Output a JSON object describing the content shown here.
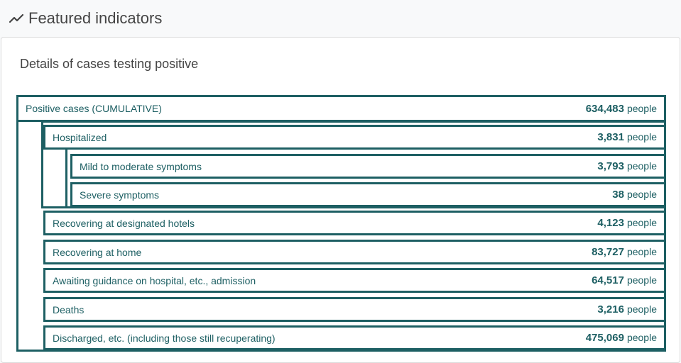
{
  "header": {
    "title": "Featured indicators",
    "icon": "trend-line-icon"
  },
  "card": {
    "title": "Details of cases testing positive"
  },
  "colors": {
    "accent": "#1d5f63",
    "text": "#444444",
    "background": "#f8f9fa"
  },
  "rows": [
    {
      "label": "Positive cases (CUMULATIVE)",
      "value": "634,483",
      "unit": "people"
    },
    {
      "label": "Hospitalized",
      "value": "3,831",
      "unit": "people"
    },
    {
      "label": "Mild to moderate symptoms",
      "value": "3,793",
      "unit": "people"
    },
    {
      "label": "Severe symptoms",
      "value": "38",
      "unit": "people"
    },
    {
      "label": "Recovering at designated hotels",
      "value": "4,123",
      "unit": "people"
    },
    {
      "label": "Recovering at home",
      "value": "83,727",
      "unit": "people"
    },
    {
      "label": "Awaiting guidance on hospital, etc., admission",
      "value": "64,517",
      "unit": "people"
    },
    {
      "label": "Deaths",
      "value": "3,216",
      "unit": "people"
    },
    {
      "label": "Discharged, etc. (including those still recuperating)",
      "value": "475,069",
      "unit": "people"
    }
  ]
}
